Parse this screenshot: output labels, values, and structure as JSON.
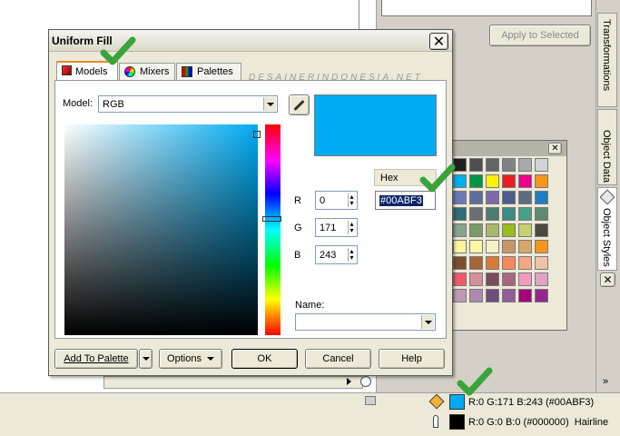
{
  "dialog": {
    "title": "Uniform Fill",
    "watermark": "DESAINERINDONESIA.NET",
    "tabs": [
      {
        "label": "Models",
        "icon": "models-icon",
        "active": true
      },
      {
        "label": "Mixers",
        "icon": "mixers-icon",
        "active": false
      },
      {
        "label": "Palettes",
        "icon": "palettes-icon",
        "active": false
      }
    ],
    "model_label": "Model:",
    "model_value": "RGB",
    "hex_label": "Hex",
    "hex_value": "#00ABF3",
    "r_label": "R",
    "r_value": "0",
    "g_label": "G",
    "g_value": "171",
    "b_label": "B",
    "b_value": "243",
    "name_label": "Name:",
    "name_value": "",
    "preview_color": "#00ABF3",
    "buttons": {
      "add_to_palette": "Add To Palette",
      "options": "Options",
      "ok": "OK",
      "cancel": "Cancel",
      "help": "Help"
    }
  },
  "background_panel": {
    "apply_button": "Apply to Selected",
    "side_tabs": [
      "Transformations",
      "Object Data",
      "Object Styles"
    ]
  },
  "status_bar": {
    "fill_text": "R:0 G:171 B:243 (#00ABF3)",
    "fill_color": "#00ABF3",
    "outline_text": "R:0 G:0 B:0 (#000000)  Hairline",
    "outline_color": "#000000"
  },
  "palette_colors": [
    [
      "#231f20",
      "#4d4d4f",
      "#636466",
      "#808285",
      "#a7a9ac",
      "#d1d3d4"
    ],
    [
      "#00aeef",
      "#009444",
      "#fff200",
      "#ed1c24",
      "#ec008c",
      "#f7941d"
    ],
    [
      "#6d78b7",
      "#5e6d9c",
      "#7d6aa9",
      "#4e5d8c",
      "#5a6e7f",
      "#1f7dc1"
    ],
    [
      "#2b6f74",
      "#6d6e71",
      "#4e7b6e",
      "#3b8b86",
      "#47a089",
      "#5e8a70"
    ],
    [
      "#8aa48f",
      "#7b9b6b",
      "#a8b86e",
      "#9cbb1e",
      "#c7cf6f",
      "#4b4b3d"
    ],
    [
      "#fff59d",
      "#fff7a6",
      "#f9f1c6",
      "#c79766",
      "#d5a76a",
      "#f7941d"
    ],
    [
      "#7b4f2d",
      "#a3653a",
      "#d77a3c",
      "#f58a5a",
      "#f5a683",
      "#f2c2a7"
    ],
    [
      "#f15a6b",
      "#d4919b",
      "#7d4b5e",
      "#a86685",
      "#f49ac1",
      "#e0a3c5"
    ],
    [
      "#c09ab5",
      "#b088b1",
      "#6f4e7c",
      "#915f95",
      "#a6007b",
      "#93278f"
    ]
  ],
  "colors": {
    "dialog_bg": "#ece9d8",
    "title_bar": "#ece9d8",
    "check_green": "#3aa43a"
  }
}
